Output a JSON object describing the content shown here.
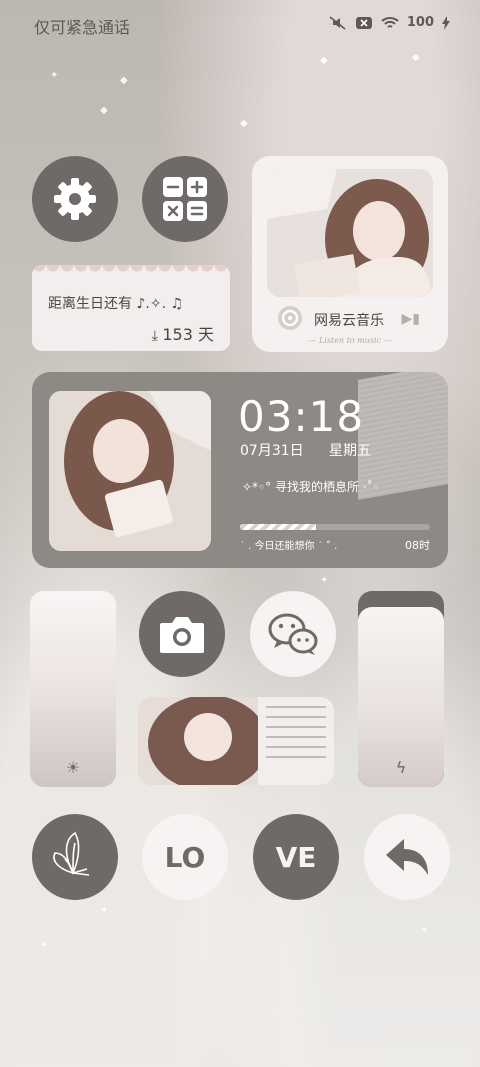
{
  "status_bar": {
    "carrier": "仅可紧急通话",
    "battery": "100",
    "icons": [
      "mute-icon",
      "no-sim-icon",
      "wifi-icon",
      "battery-icon",
      "charging-icon"
    ]
  },
  "shortcuts": {
    "settings": "gear-icon",
    "calculator": "calculator-icon",
    "camera": "camera-icon",
    "wechat": "wechat-icon",
    "butterfly": "butterfly-icon",
    "back": "back-arrow-icon"
  },
  "birthday_widget": {
    "label": "距离生日还有 ♪.✧. ♫",
    "days": "153",
    "unit": "天"
  },
  "music_widget": {
    "app_name": "网易云音乐",
    "subtitle": "--- Listen to music ---"
  },
  "clock_widget": {
    "time": "03:18",
    "date": "07月31日",
    "weekday": "星期五",
    "quote": "✧*◦° 寻找我的栖息所 ·˚◦",
    "footer": "˙ . 今日还能想你 ˙ ˚ .",
    "hours": "08时",
    "progress": 0.4
  },
  "sliders": {
    "brightness_icon": "sun-icon",
    "power_icon": "lightning-icon"
  },
  "love_buttons": {
    "left": "LO",
    "right": "VE"
  },
  "colors": {
    "dark_button": "#6f6a68",
    "light_button": "#f6f3f2",
    "widget_gray": "#8d8985"
  }
}
